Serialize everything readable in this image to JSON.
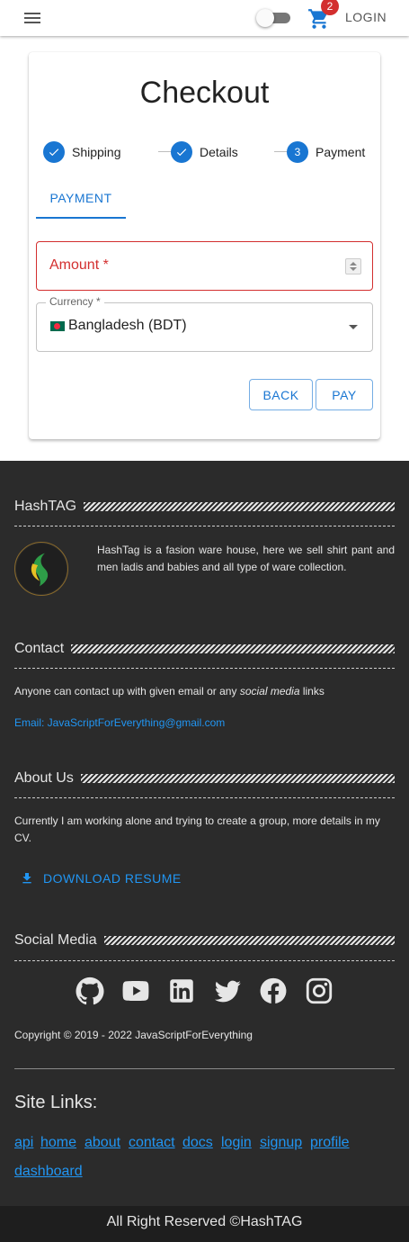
{
  "appbar": {
    "login_label": "LOGIN",
    "cart_count": "2"
  },
  "checkout": {
    "title": "Checkout",
    "steps": [
      {
        "label": "Shipping",
        "state": "completed"
      },
      {
        "label": "Details",
        "state": "completed"
      },
      {
        "label": "Payment",
        "number": "3",
        "state": "active"
      }
    ],
    "tab_label": "PAYMENT",
    "amount_label": "Amount *",
    "currency_label": "Currency *",
    "currency_value": "Bangladesh (BDT)",
    "back_label": "BACK",
    "pay_label": "PAY"
  },
  "footer": {
    "brand_heading": "HashTAG",
    "brand_text": "HashTag is a fasion ware house, here we sell shirt pant and men ladis and babies and all type of ware collection.",
    "contact_heading": "Contact",
    "contact_text_1": "Anyone can contact up with given email or any ",
    "contact_text_em": "social media",
    "contact_text_2": " links",
    "email_text": "Email: JavaScriptForEverything@gmail.com",
    "about_heading": "About Us",
    "about_text": "Currently I am working alone and trying to create a group, more details in my CV.",
    "download_label": "DOWNLOAD RESUME",
    "social_heading": "Social Media",
    "social_icons": [
      "github-icon",
      "youtube-icon",
      "linkedin-icon",
      "twitter-icon",
      "facebook-icon",
      "instagram-icon"
    ],
    "copyright": "Copyright © 2019 - 2022 JavaScriptForEverything",
    "site_links_title": "Site Links:",
    "site_links": [
      "api",
      "home",
      "about",
      "contact",
      "docs",
      "login",
      "signup",
      "profile",
      "dashboard"
    ],
    "bottom_text": "All Right Reserved ©HashTAG"
  },
  "colors": {
    "primary": "#1976d2",
    "error": "#d32f2f",
    "footer_bg": "#2b2b2b",
    "link": "#2196f3"
  }
}
